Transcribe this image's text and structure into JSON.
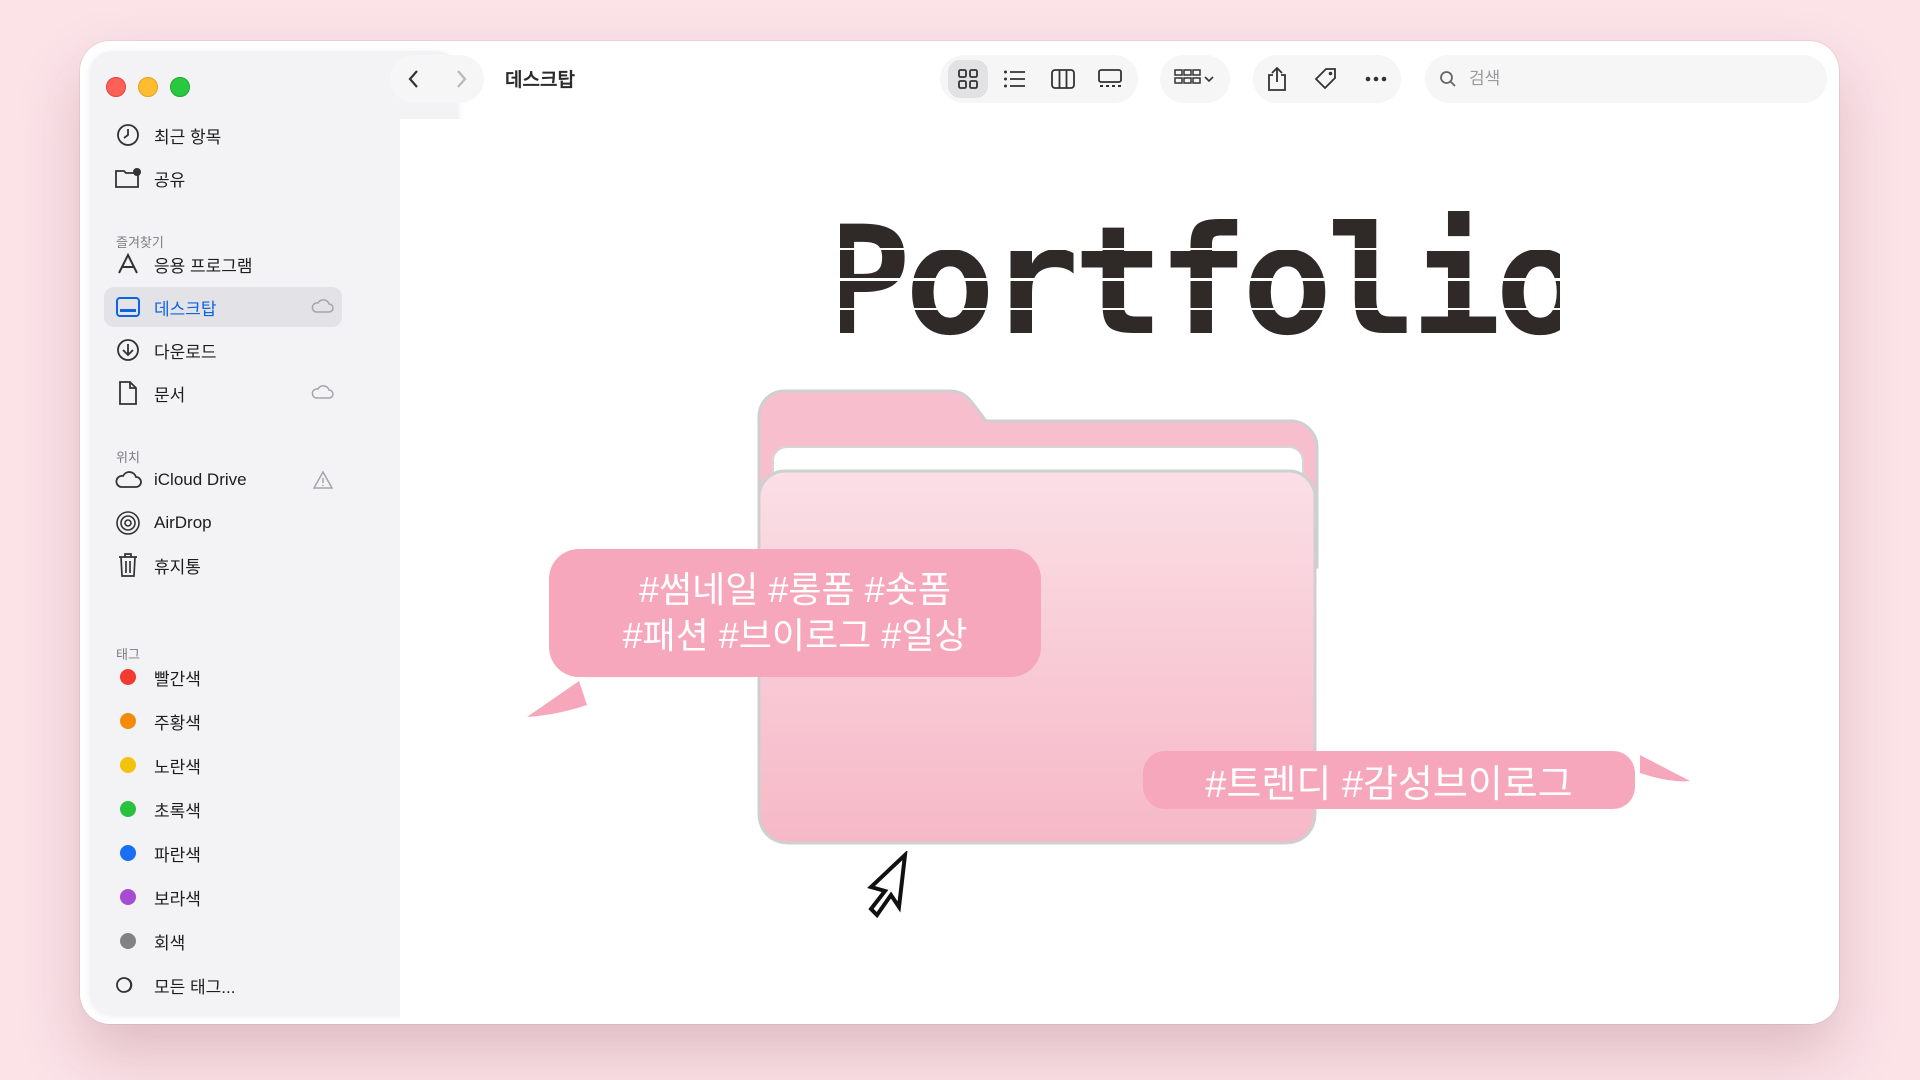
{
  "window": {
    "title": "데스크탑",
    "traffic_lights": [
      "close",
      "minimize",
      "zoom"
    ]
  },
  "sidebar": {
    "top_items": [
      {
        "label": "최근 항목",
        "icon": "clock-icon"
      },
      {
        "label": "공유",
        "icon": "shared-folder-icon"
      }
    ],
    "favorites_header": "즐겨찾기",
    "favorites": [
      {
        "label": "응용 프로그램",
        "icon": "applications-icon"
      },
      {
        "label": "데스크탑",
        "icon": "desktop-icon",
        "active": true,
        "badge": "cloud-icon"
      },
      {
        "label": "다운로드",
        "icon": "download-icon"
      },
      {
        "label": "문서",
        "icon": "document-icon",
        "badge": "cloud-icon"
      }
    ],
    "locations_header": "위치",
    "locations": [
      {
        "label": "iCloud Drive",
        "icon": "cloud-icon",
        "badge": "warning-icon"
      },
      {
        "label": "AirDrop",
        "icon": "airdrop-icon"
      },
      {
        "label": "휴지통",
        "icon": "trash-icon"
      }
    ],
    "tags_header": "태그",
    "tags": [
      {
        "label": "빨간색",
        "color": "#f23a30"
      },
      {
        "label": "주황색",
        "color": "#f58a0b"
      },
      {
        "label": "노란색",
        "color": "#f5c20a"
      },
      {
        "label": "초록색",
        "color": "#2ac13f"
      },
      {
        "label": "파란색",
        "color": "#1a6ef5"
      },
      {
        "label": "보라색",
        "color": "#a54cd2"
      },
      {
        "label": "회색",
        "color": "#818186"
      }
    ],
    "all_tags": "모든 태그..."
  },
  "toolbar": {
    "back_icon": "chevron-left-icon",
    "forward_icon": "chevron-right-icon",
    "view_modes": [
      "icon-view-icon",
      "list-view-icon",
      "column-view-icon",
      "gallery-view-icon"
    ],
    "selected_view": "icon-view-icon",
    "group_icon": "group-by-icon",
    "actions": [
      "share-icon",
      "tag-icon",
      "more-icon"
    ],
    "search_placeholder": "검색"
  },
  "content": {
    "heading": "Portfolio",
    "bubble_left_line1": "#썸네일 #롱폼 #숏폼",
    "bubble_left_line2": "#패션 #브이로그 #일상",
    "bubble_right": "#트렌디 #감성브이로그",
    "colors": {
      "folder_pink": "#f7bfcd",
      "bubble_pink": "#f6a7bb",
      "heading_dark": "#2f2a28"
    }
  }
}
